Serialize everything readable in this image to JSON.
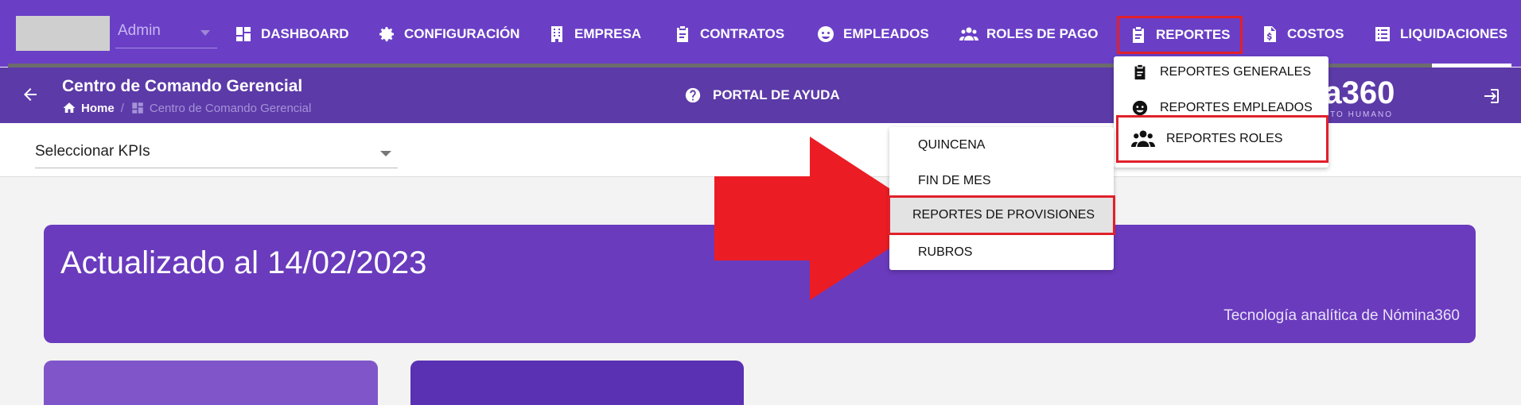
{
  "user": {
    "name": "Admin"
  },
  "nav": [
    {
      "key": "dashboard",
      "label": "DASHBOARD",
      "icon": "dashboard-icon"
    },
    {
      "key": "configuracion",
      "label": "CONFIGURACIÓN",
      "icon": "gear-icon"
    },
    {
      "key": "empresa",
      "label": "EMPRESA",
      "icon": "building-icon"
    },
    {
      "key": "contratos",
      "label": "CONTRATOS",
      "icon": "clipboard-icon"
    },
    {
      "key": "empleados",
      "label": "EMPLEADOS",
      "icon": "face-icon"
    },
    {
      "key": "roles",
      "label": "ROLES DE PAGO",
      "icon": "people-icon"
    },
    {
      "key": "reportes",
      "label": "REPORTES",
      "icon": "clipboard-icon"
    },
    {
      "key": "costos",
      "label": "COSTOS",
      "icon": "invoice-dollar-icon"
    },
    {
      "key": "liquidaciones",
      "label": "LIQUIDACIONES",
      "icon": "list-icon"
    }
  ],
  "subheader": {
    "title": "Centro de Comando Gerencial",
    "breadcrumb_home": "Home",
    "breadcrumb_sep": "/",
    "breadcrumb_current": "Centro de Comando Gerencial",
    "help_label": "PORTAL DE AYUDA",
    "brand": "na360",
    "brand_sub": "ALENTO HUMANO"
  },
  "kpi": {
    "placeholder": "Seleccionar KPIs"
  },
  "banner": {
    "title": "Actualizado al 14/02/2023",
    "footer": "Tecnología analítica de Nómina360"
  },
  "reportes_menu": [
    {
      "label": "REPORTES GENERALES",
      "icon": "clipboard-icon"
    },
    {
      "label": "REPORTES EMPLEADOS",
      "icon": "face-icon"
    },
    {
      "label": "REPORTES ROLES",
      "icon": "people-icon"
    }
  ],
  "roles_submenu": [
    {
      "label": "QUINCENA"
    },
    {
      "label": "FIN DE MES"
    },
    {
      "label": "REPORTES DE PROVISIONES"
    },
    {
      "label": "RUBROS"
    }
  ],
  "colors": {
    "primary": "#6a3fc6",
    "subheader": "#5c3aa8",
    "highlight": "#e0202a"
  }
}
